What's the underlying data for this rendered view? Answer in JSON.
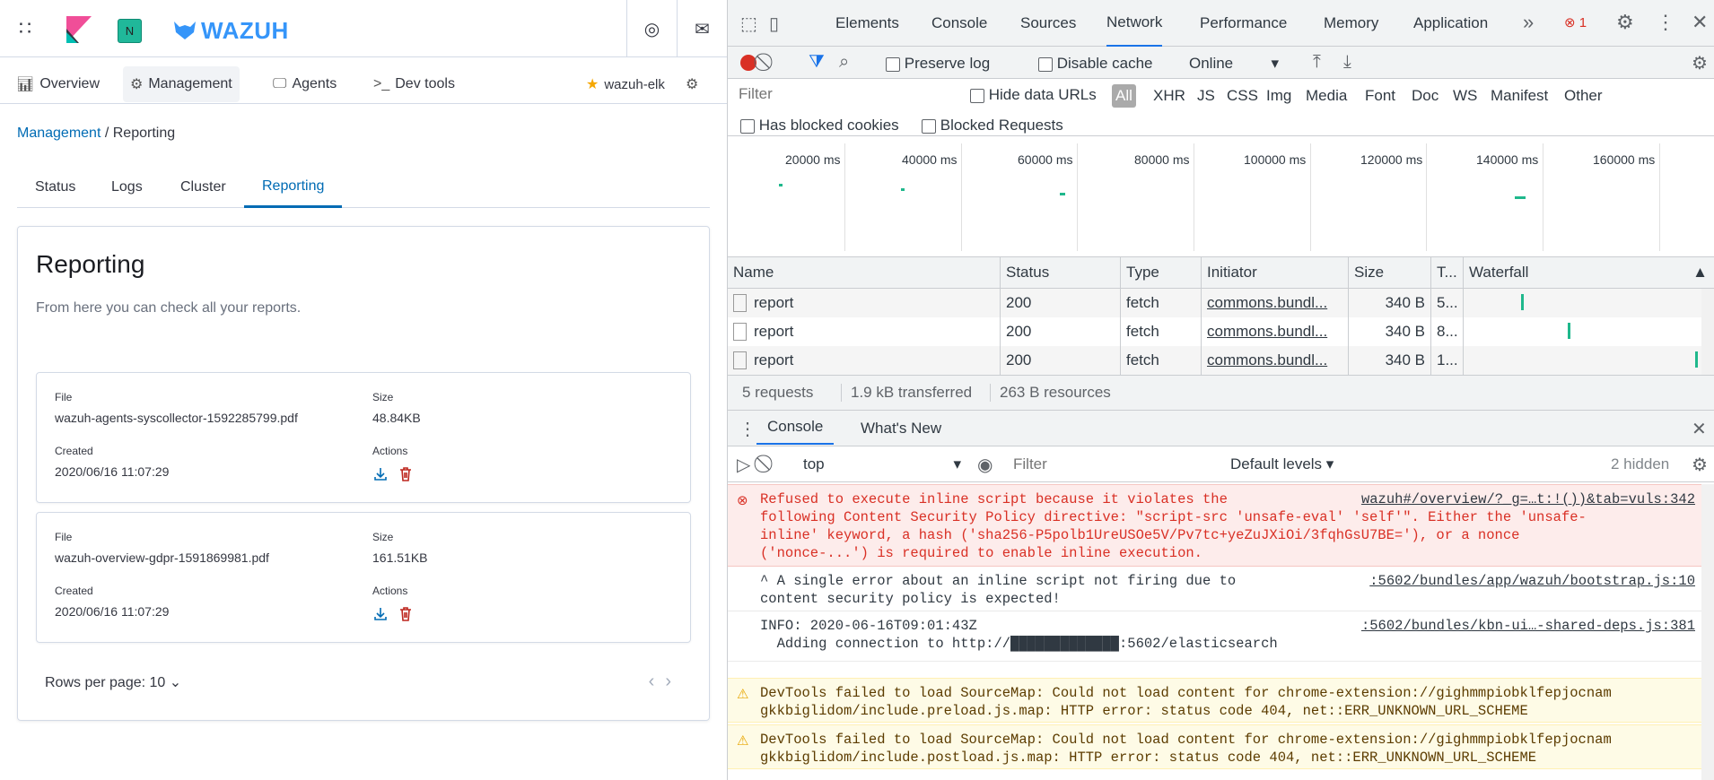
{
  "app": {
    "header": {
      "avatar_letter": "N",
      "brand": "WAZUH"
    },
    "nav": {
      "overview": "Overview",
      "management": "Management",
      "agents": "Agents",
      "devtools": "Dev tools",
      "cluster_name": "wazuh-elk"
    },
    "breadcrumb": {
      "parent": "Management",
      "separator": " / ",
      "current": "Reporting"
    },
    "tabs": [
      "Status",
      "Logs",
      "Cluster",
      "Reporting"
    ],
    "panel": {
      "title": "Reporting",
      "description": "From here you can check all your reports.",
      "labels": {
        "file": "File",
        "size": "Size",
        "created": "Created",
        "actions": "Actions"
      },
      "reports": [
        {
          "file": "wazuh-agents-syscollector-1592285799.pdf",
          "size": "48.84KB",
          "created": "2020/06/16 11:07:29"
        },
        {
          "file": "wazuh-overview-gdpr-1591869981.pdf",
          "size": "161.51KB",
          "created": "2020/06/16 11:07:29"
        }
      ],
      "rows_per_page": "Rows per page: 10"
    }
  },
  "devtools": {
    "tabs": [
      "Elements",
      "Console",
      "Sources",
      "Network",
      "Performance",
      "Memory",
      "Application"
    ],
    "active_tab": "Network",
    "error_count": "1",
    "toolbar": {
      "preserve_log": "Preserve log",
      "disable_cache": "Disable cache",
      "throttle": "Online"
    },
    "filter": {
      "placeholder": "Filter",
      "hide_data_urls": "Hide data URLs",
      "types": [
        "All",
        "XHR",
        "JS",
        "CSS",
        "Img",
        "Media",
        "Font",
        "Doc",
        "WS",
        "Manifest",
        "Other"
      ],
      "has_blocked_cookies": "Has blocked cookies",
      "blocked_requests": "Blocked Requests"
    },
    "timeline_ticks": [
      "20000 ms",
      "40000 ms",
      "60000 ms",
      "80000 ms",
      "100000 ms",
      "120000 ms",
      "140000 ms",
      "160000 ms"
    ],
    "table": {
      "headers": [
        "Name",
        "Status",
        "Type",
        "Initiator",
        "Size",
        "T...",
        "Waterfall"
      ],
      "rows": [
        {
          "name": "report",
          "status": "200",
          "type": "fetch",
          "initiator": "commons.bundl...",
          "size": "340 B",
          "time": "5..."
        },
        {
          "name": "report",
          "status": "200",
          "type": "fetch",
          "initiator": "commons.bundl...",
          "size": "340 B",
          "time": "8..."
        },
        {
          "name": "report",
          "status": "200",
          "type": "fetch",
          "initiator": "commons.bundl...",
          "size": "340 B",
          "time": "1..."
        }
      ]
    },
    "summary": {
      "requests": "5 requests",
      "transferred": "1.9 kB transferred",
      "resources": "263 B resources"
    },
    "drawer": {
      "tabs": [
        "Console",
        "What's New"
      ],
      "context": "top",
      "filter_placeholder": "Filter",
      "levels": "Default levels",
      "hidden": "2 hidden",
      "messages": [
        {
          "level": "error",
          "text": "Refused to execute inline script because it violates the\nfollowing Content Security Policy directive: \"script-src 'unsafe-eval' 'self'\". Either the 'unsafe-\ninline' keyword, a hash ('sha256-P5polb1UreUSOe5V/Pv7tc+yeZuJXiOi/3fqhGsU7BE='), or a nonce\n('nonce-...') is required to enable inline execution.",
          "source": "wazuh#/overview/?_g=…t:!())&tab=vuls:342"
        },
        {
          "level": "info",
          "text": "^ A single error about an inline script not firing due to\ncontent security policy is expected!",
          "source": ":5602/bundles/app/wazuh/bootstrap.js:10"
        },
        {
          "level": "info",
          "text": "INFO: 2020-06-16T09:01:43Z\n  Adding connection to http://█████████████:5602/elasticsearch",
          "source": ":5602/bundles/kbn-ui…-shared-deps.js:381"
        },
        {
          "level": "warning",
          "text": "DevTools failed to load SourceMap: Could not load content for chrome-extension://gighmmpiobklfepjocnam\ngkkbiglidom/include.preload.js.map: HTTP error: status code 404, net::ERR_UNKNOWN_URL_SCHEME",
          "source": ""
        },
        {
          "level": "warning",
          "text": "DevTools failed to load SourceMap: Could not load content for chrome-extension://gighmmpiobklfepjocnam\ngkkbiglidom/include.postload.js.map: HTTP error: status code 404, net::ERR_UNKNOWN_URL_SCHEME",
          "source": ""
        }
      ]
    }
  }
}
